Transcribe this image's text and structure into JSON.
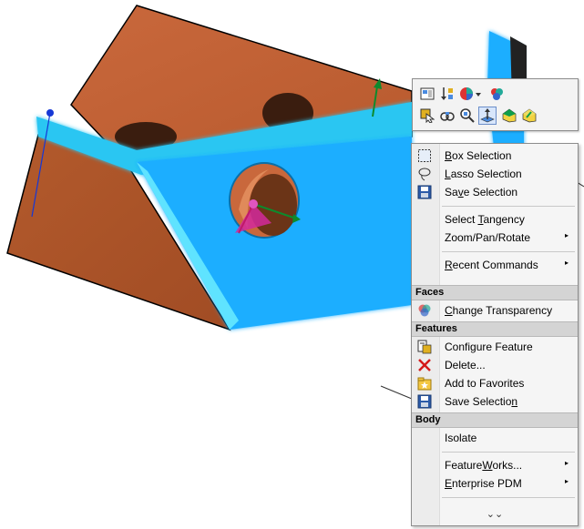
{
  "toolbar": {
    "row1": [
      {
        "icon": "view-orientation-icon"
      },
      {
        "icon": "sort-icon"
      },
      {
        "icon": "appearance-icon"
      },
      {
        "icon": "scene-icon"
      }
    ],
    "row2": [
      {
        "icon": "select-icon"
      },
      {
        "icon": "hide-show-icon"
      },
      {
        "icon": "zoom-to-selection-icon"
      },
      {
        "icon": "normal-to-icon"
      },
      {
        "icon": "sketch-icon"
      },
      {
        "icon": "edit-sketch-icon"
      }
    ]
  },
  "menu": {
    "items_top": [
      {
        "label": "Box Selection",
        "accel": "B",
        "rest": "ox Selection",
        "icon": "box-selection-icon",
        "submenu": false
      },
      {
        "label": "Lasso Selection",
        "accel": "L",
        "rest": "asso Selection",
        "icon": "lasso-selection-icon",
        "submenu": false
      },
      {
        "label": "Save Selection",
        "pre": "Sa",
        "accel": "v",
        "rest": "e Selection",
        "icon": "save-selection-icon",
        "submenu": false
      },
      {
        "label": "Select Tangency",
        "pre": "Select ",
        "accel": "T",
        "rest": "angency",
        "icon": "",
        "submenu": false
      },
      {
        "label": "Zoom/Pan/Rotate",
        "icon": "",
        "submenu": true
      },
      {
        "label": "Recent Commands",
        "accel": "R",
        "rest": "ecent Commands",
        "icon": "",
        "submenu": true
      }
    ],
    "faces_header": "Faces",
    "faces_items": [
      {
        "label": "Change Transparency",
        "accel": "C",
        "rest": "hange Transparency",
        "icon": "transparency-icon"
      }
    ],
    "features_header": "Features",
    "features_items": [
      {
        "label": "Configure Feature",
        "icon": "configure-feature-icon"
      },
      {
        "label": "Delete...",
        "icon": "delete-icon"
      },
      {
        "label": "Add to Favorites",
        "icon": "favorites-icon"
      },
      {
        "label": "Save Selection",
        "pre": "Save Selectio",
        "accel": "n",
        "icon": "save-selection-icon"
      }
    ],
    "body_header": "Body",
    "body_items": [
      {
        "label": "Isolate",
        "icon": ""
      },
      {
        "label": "FeatureWorks...",
        "pre": "Feature",
        "accel": "W",
        "rest": "orks...",
        "icon": "",
        "submenu": true
      },
      {
        "label": "Enterprise PDM",
        "accel": "E",
        "rest": "nterprise PDM",
        "icon": "",
        "submenu": true
      }
    ],
    "more_icon": "expand-more-icon",
    "more_glyph": "⌄⌄"
  },
  "colors": {
    "model_orange": "#c8653a",
    "selected_face": "#1aaeff",
    "menu_bg": "#f5f5f5",
    "header_bg": "#d4d4d4"
  }
}
